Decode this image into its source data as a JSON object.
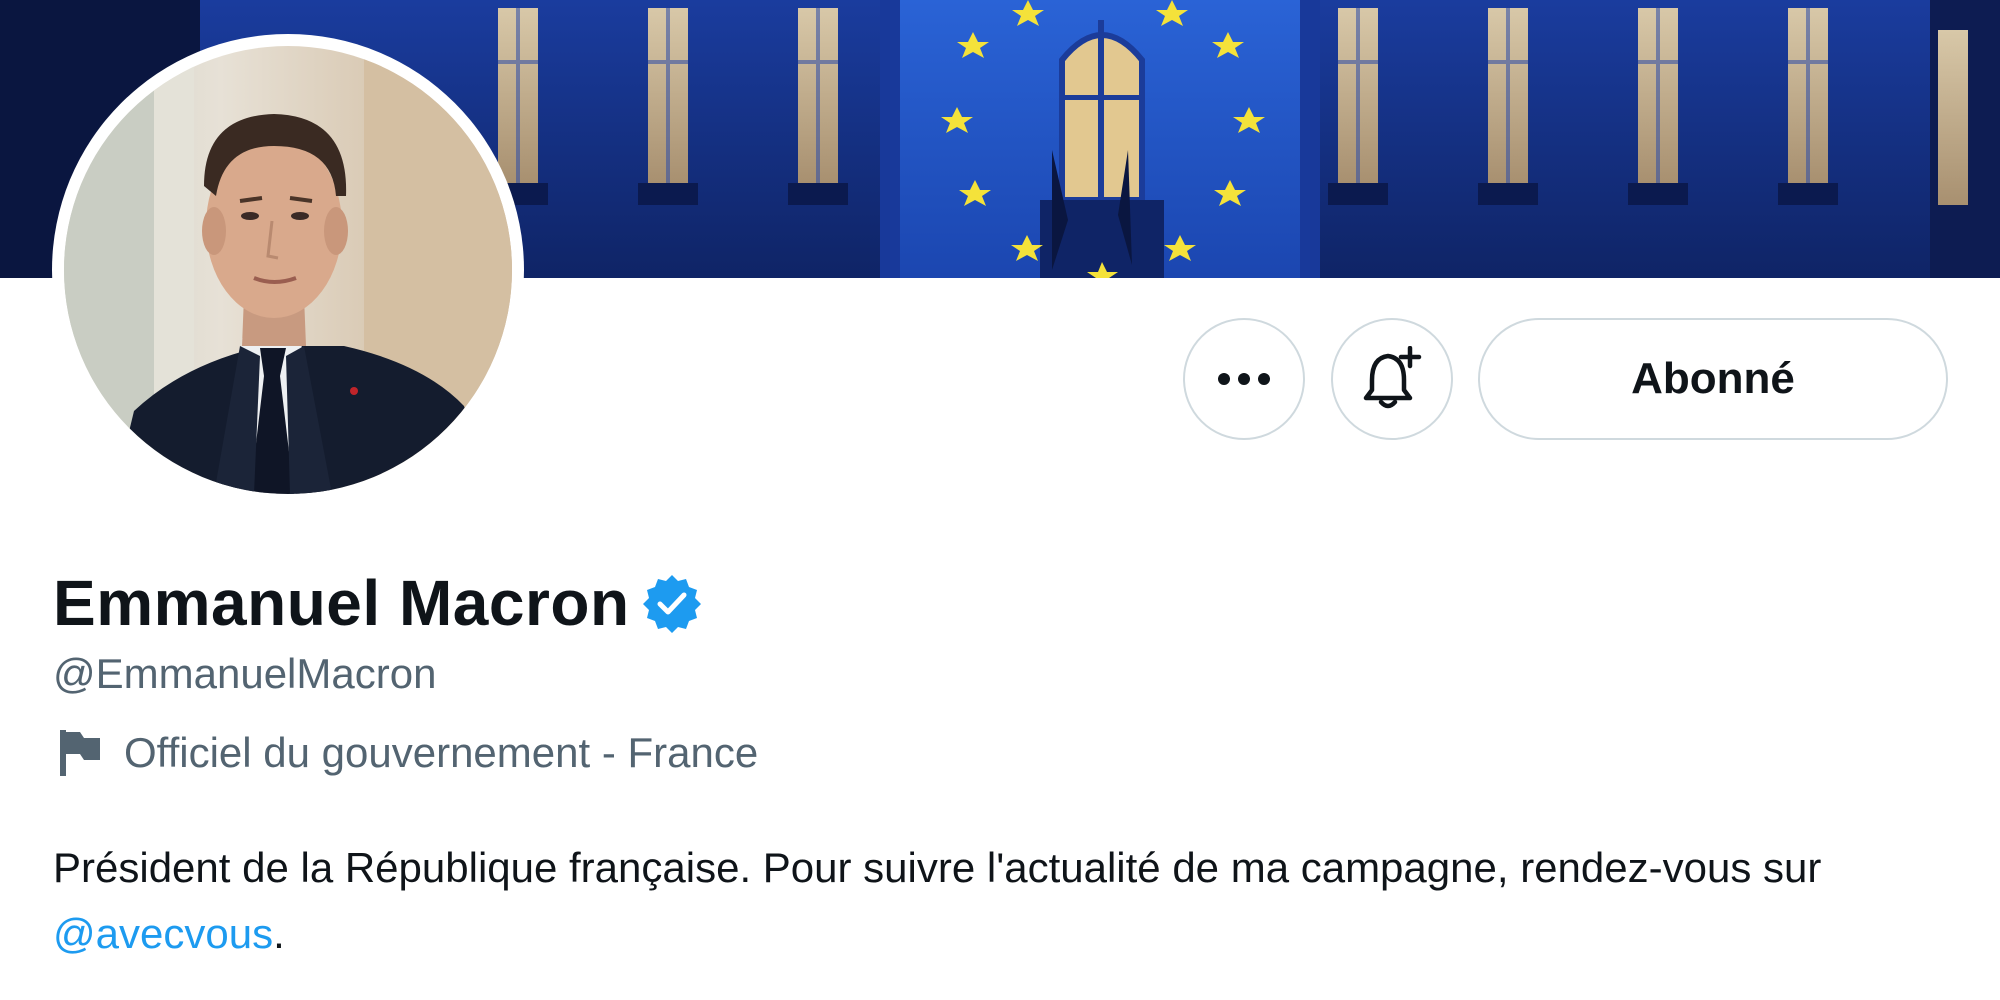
{
  "profile": {
    "display_name": "Emmanuel Macron",
    "handle": "@EmmanuelMacron",
    "affiliation_label": "Officiel du gouvernement - France",
    "bio_text": "Président de la République française. Pour suivre l'actualité de ma campagne, rendez-vous sur ",
    "bio_mention": "@avecvous",
    "bio_end": "."
  },
  "actions": {
    "more_icon": "ellipsis-icon",
    "notify_icon": "bell-plus-icon",
    "follow_label": "Abonné"
  },
  "icons": {
    "verified": "verified-badge-icon",
    "affiliation": "flag-icon"
  },
  "colors": {
    "accent": "#1d9bf0",
    "text_primary": "#0f1419",
    "text_secondary": "#536471",
    "border": "#cfd9de",
    "eu_star": "#f4e23a"
  }
}
